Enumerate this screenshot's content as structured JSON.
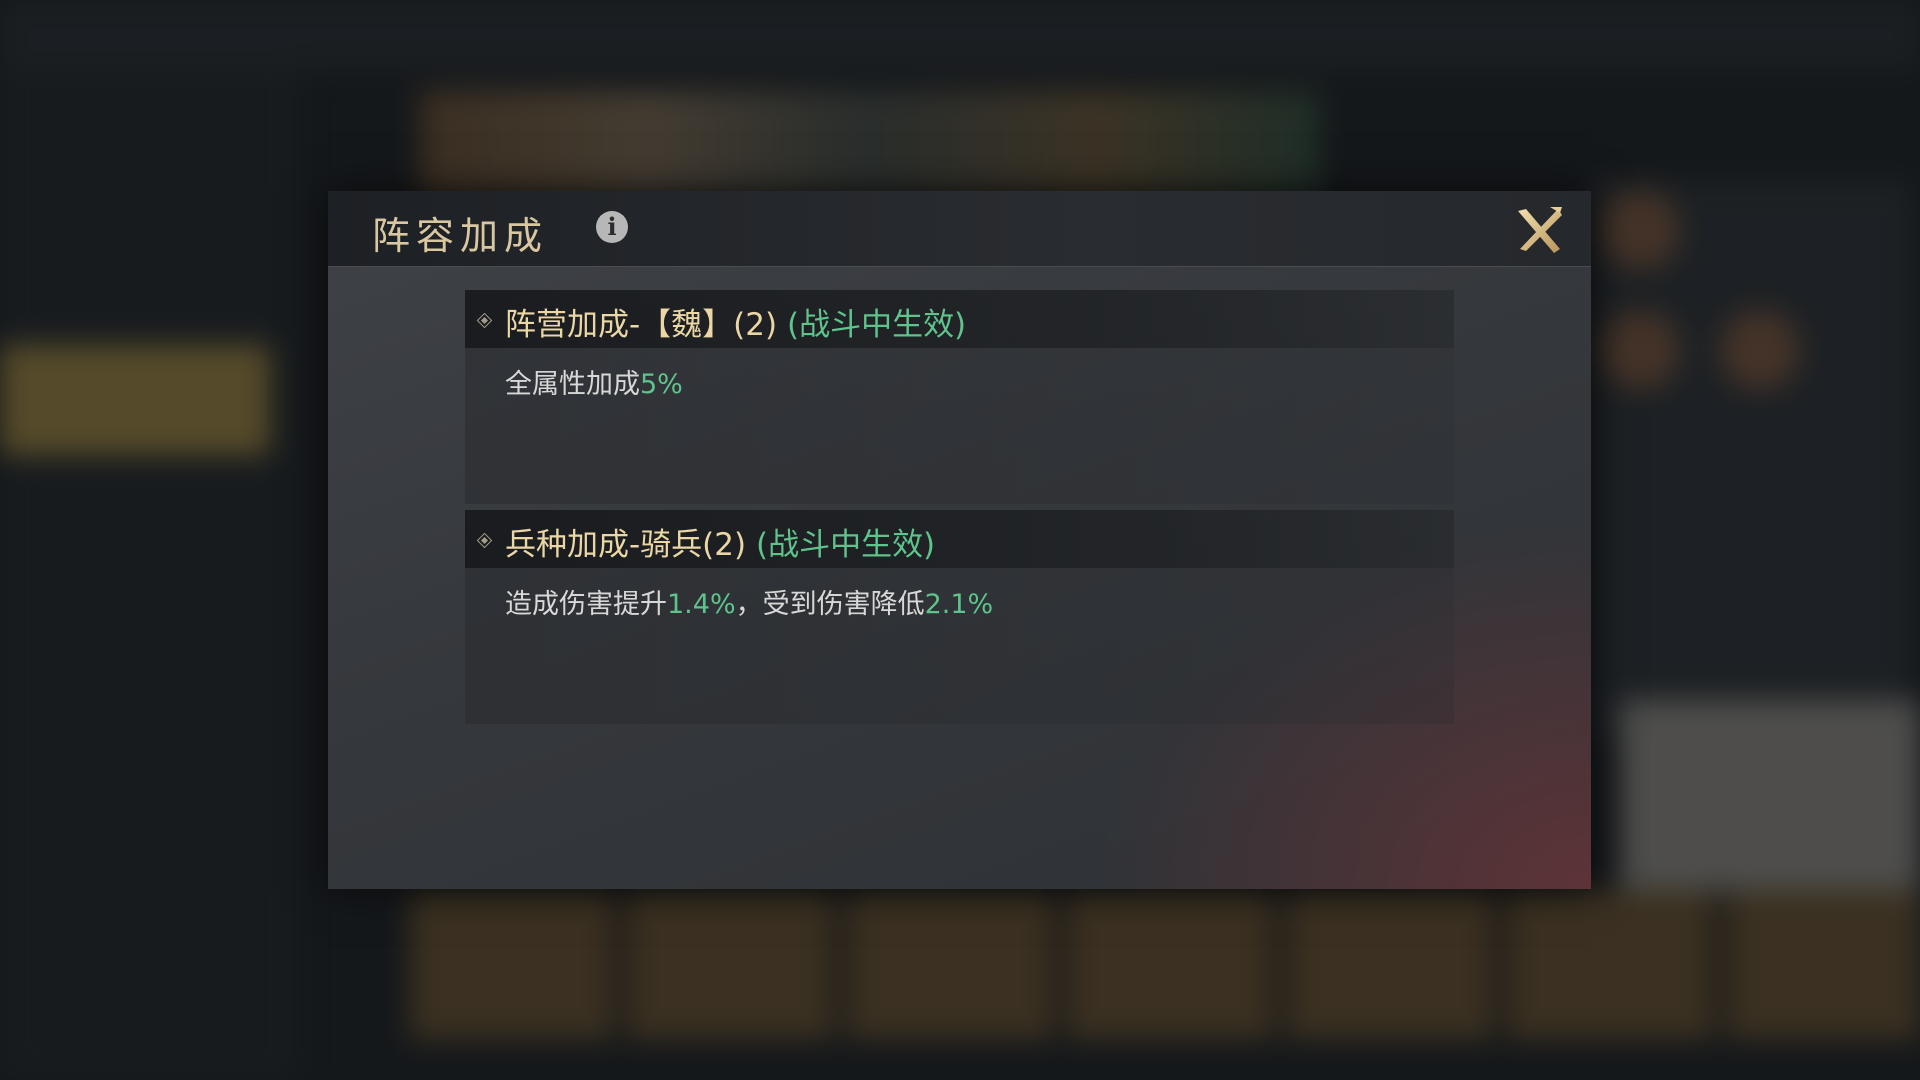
{
  "dialog": {
    "title": "阵容加成",
    "sections": [
      {
        "name": "阵营加成-【魏】(2)",
        "effect_note": "(战斗中生效)",
        "description": [
          {
            "text": "全属性加成",
            "highlight": false
          },
          {
            "text": "5%",
            "highlight": true
          }
        ]
      },
      {
        "name": "兵种加成-骑兵(2)",
        "effect_note": "(战斗中生效)",
        "description": [
          {
            "text": "造成伤害提升",
            "highlight": false
          },
          {
            "text": "1.4%",
            "highlight": true
          },
          {
            "text": "，受到伤害降低",
            "highlight": false
          },
          {
            "text": "2.1%",
            "highlight": true
          }
        ]
      }
    ]
  },
  "icons": {
    "info": "info-icon",
    "close": "close-icon",
    "bullet": "diamond-icon"
  },
  "colors": {
    "title": "#d9c7a2",
    "section_name": "#ead7a5",
    "highlight": "#5ec48c",
    "text": "#d8d8d8"
  }
}
